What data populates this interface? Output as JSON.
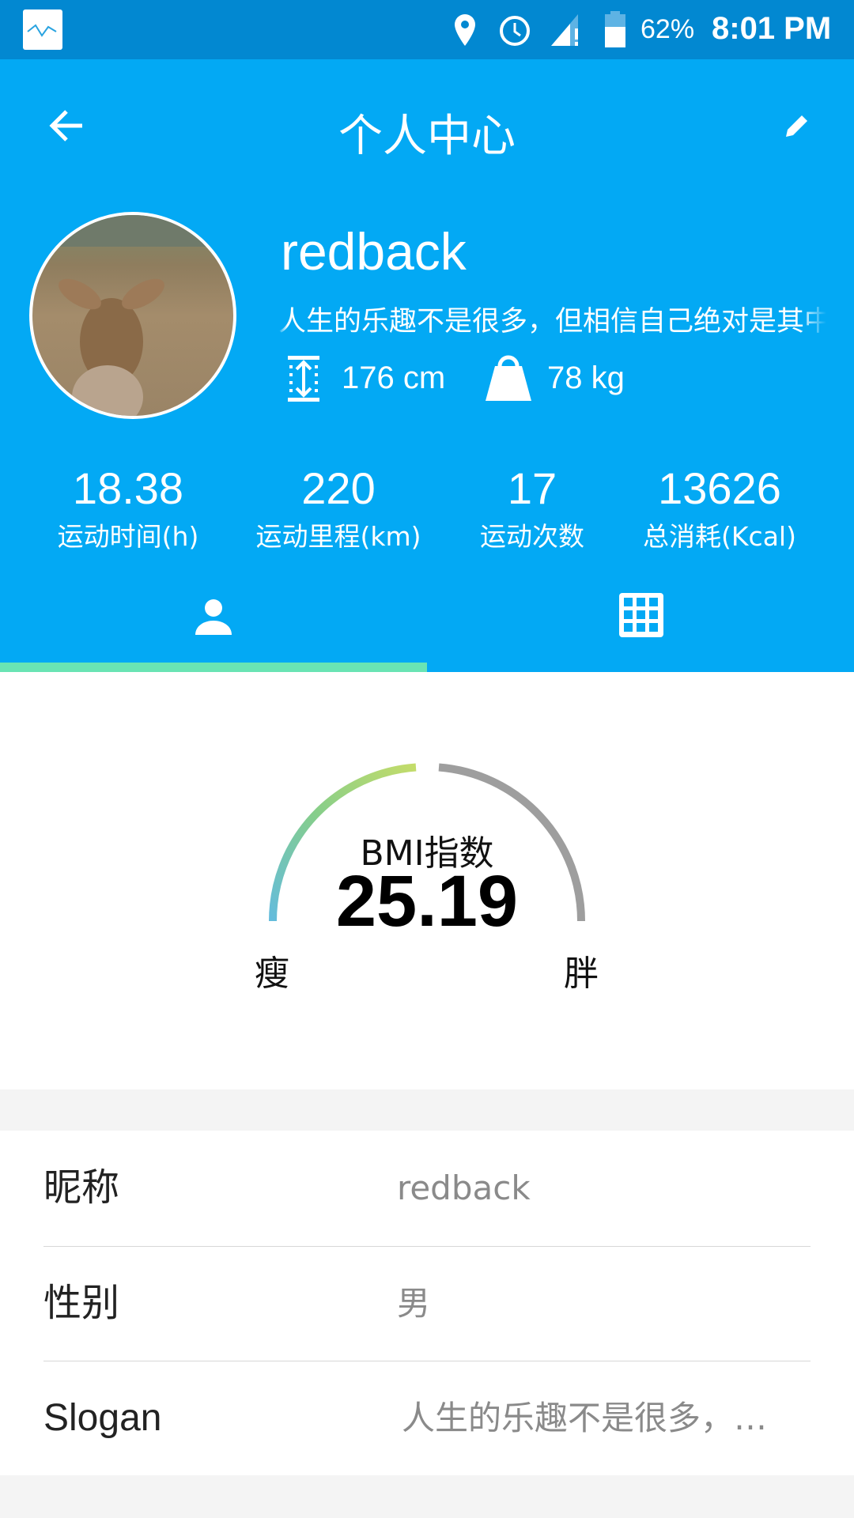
{
  "status": {
    "battery": "62%",
    "time": "8:01 PM"
  },
  "header": {
    "title": "个人中心"
  },
  "profile": {
    "name": "redback",
    "slogan": "人生的乐趣不是很多，但相信自己绝对是其中之一",
    "height": "176 cm",
    "weight": "78 kg"
  },
  "stats": [
    {
      "value": "18.38",
      "label": "运动时间(h)"
    },
    {
      "value": "220",
      "label": "运动里程(km)"
    },
    {
      "value": "17",
      "label": "运动次数"
    },
    {
      "value": "13626",
      "label": "总消耗(Kcal)"
    }
  ],
  "tabs": {
    "active": 0
  },
  "bmi": {
    "label": "BMI指数",
    "value": "25.19",
    "min_label": "瘦",
    "max_label": "胖",
    "fraction": 0.5
  },
  "colors": {
    "status": "#0288d1",
    "primary": "#03a9f4",
    "indicator": "#69e4b4"
  },
  "info": [
    {
      "key": "昵称",
      "value": "redback"
    },
    {
      "key": "性别",
      "value": "男"
    },
    {
      "key": "Slogan",
      "value": "人生的乐趣不是很多，…"
    }
  ]
}
